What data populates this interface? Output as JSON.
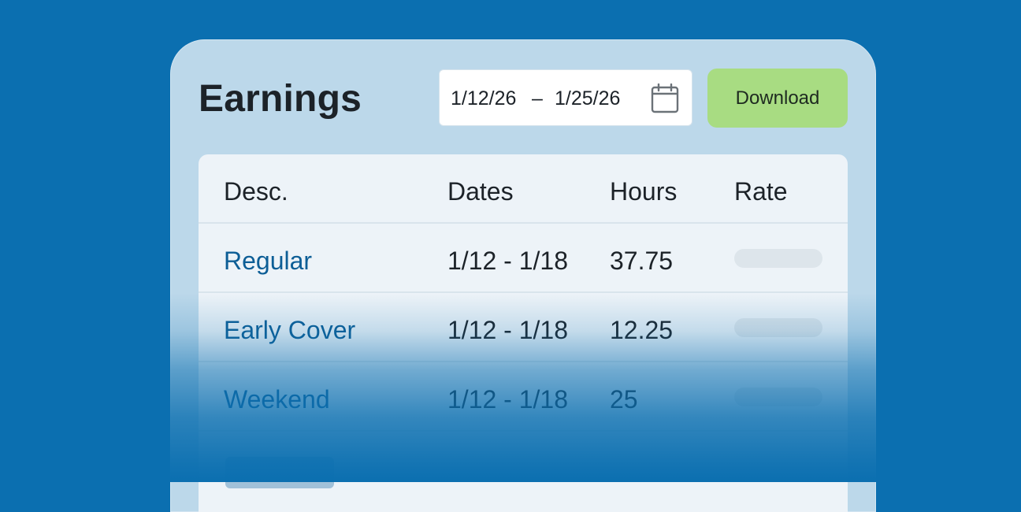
{
  "colors": {
    "background": "#0b6fb0",
    "card": "#bcd8ea",
    "download_button": "#a8dc82",
    "link_text": "#0d5e96"
  },
  "header": {
    "title": "Earnings",
    "date_range": {
      "start": "1/12/26",
      "separator": "–",
      "end": "1/25/26",
      "icon": "calendar-icon"
    },
    "download_label": "Download"
  },
  "table": {
    "columns": [
      "Desc.",
      "Dates",
      "Hours",
      "Rate"
    ],
    "rows": [
      {
        "desc": "Regular",
        "dates": "1/12 - 1/18",
        "hours": "37.75"
      },
      {
        "desc": "Early Cover",
        "dates": "1/12 - 1/18",
        "hours": "12.25"
      },
      {
        "desc": "Weekend",
        "dates": "1/12 - 1/18",
        "hours": "25"
      }
    ]
  }
}
